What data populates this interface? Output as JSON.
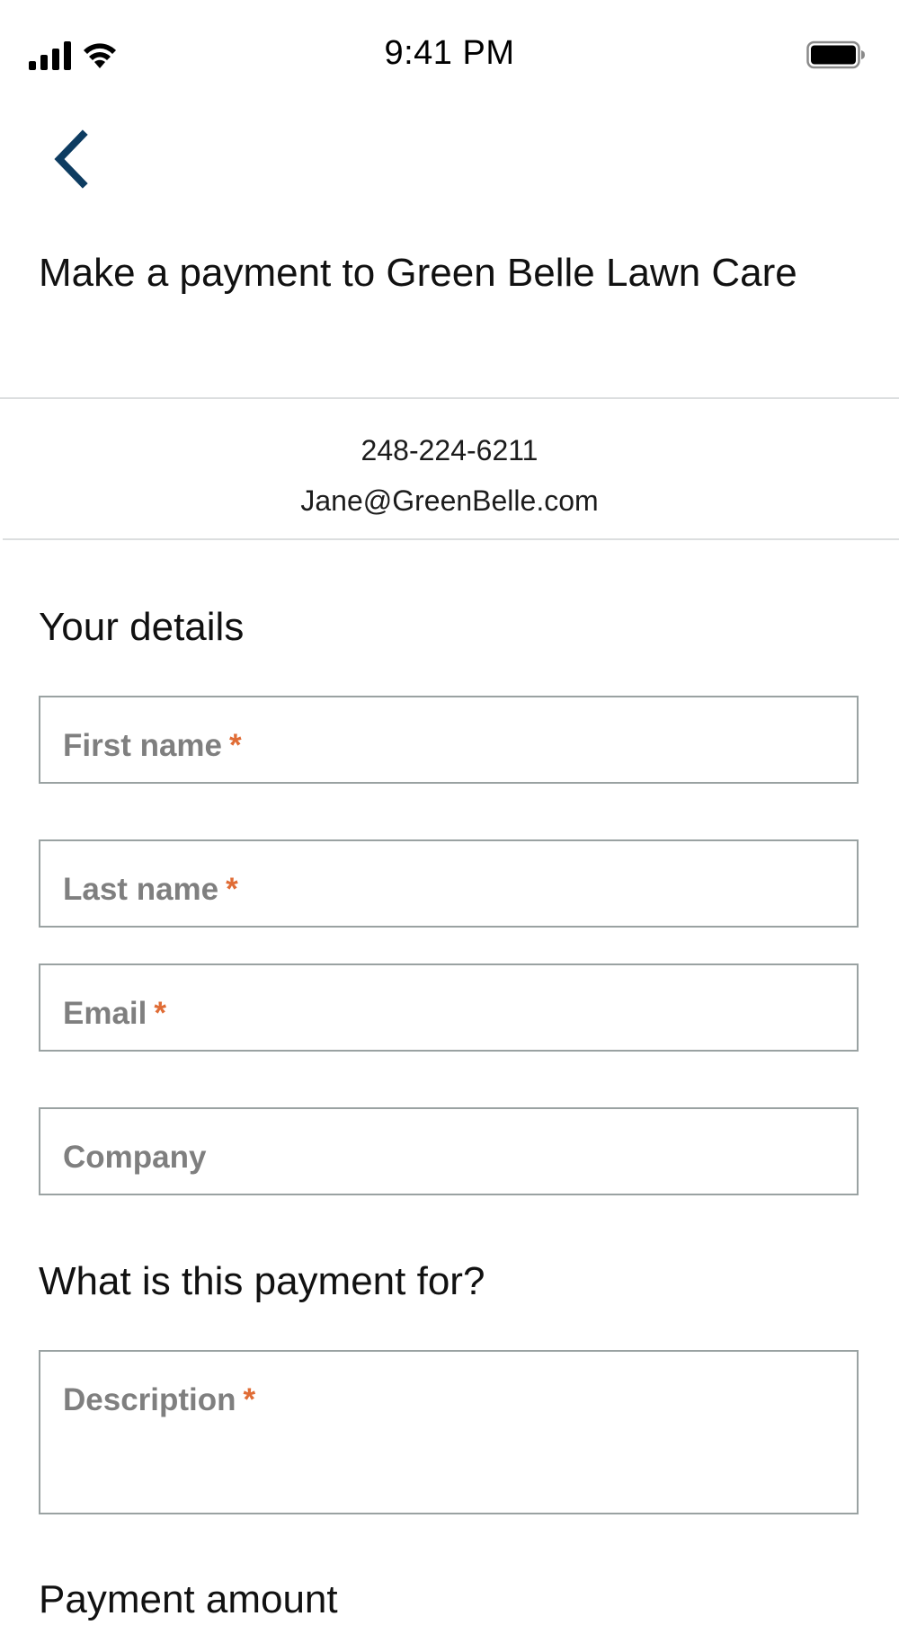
{
  "status_bar": {
    "time": "9:41 PM",
    "icons": [
      "cellular-signal-icon",
      "wifi-icon",
      "battery-icon"
    ]
  },
  "nav": {
    "back_icon": "chevron-left-icon"
  },
  "page": {
    "title": "Make a payment to Green Belle Lawn Care"
  },
  "contact": {
    "phone": "248-224-6211",
    "email": "Jane@GreenBelle.com"
  },
  "details_section": {
    "heading": "Your details",
    "fields": [
      {
        "label": "First name",
        "required_mark": "*"
      },
      {
        "label": "Last name",
        "required_mark": "*"
      },
      {
        "label": "Email",
        "required_mark": "*"
      },
      {
        "label": "Company",
        "required_mark": ""
      }
    ]
  },
  "purpose_section": {
    "heading": "What is this payment for?",
    "description_label": "Description",
    "description_required_mark": "*"
  },
  "amount_section": {
    "heading": "Payment amount"
  },
  "colors": {
    "accent": "#0d3c61",
    "required": "#e06c35",
    "field_border": "#9aa2a2",
    "placeholder": "#7f7f7f",
    "divider": "#dcdedf"
  }
}
